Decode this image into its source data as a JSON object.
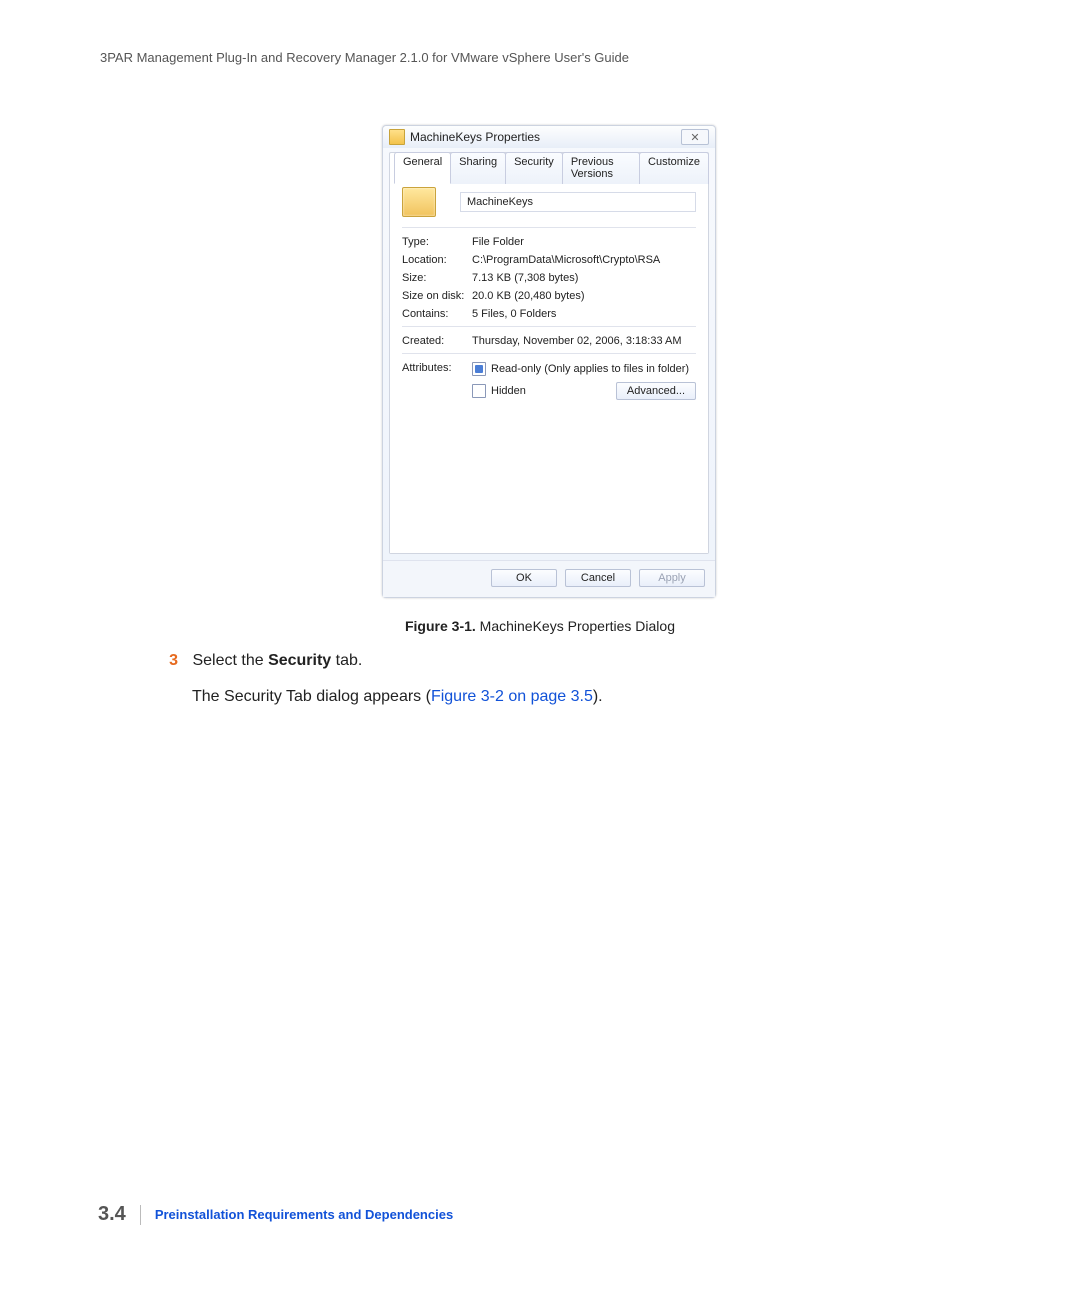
{
  "header": "3PAR Management Plug-In and Recovery Manager 2.1.0 for VMware vSphere User's Guide",
  "dialog": {
    "title": "MachineKeys Properties",
    "tabs": [
      "General",
      "Sharing",
      "Security",
      "Previous Versions",
      "Customize"
    ],
    "folderName": "MachineKeys",
    "props": {
      "type": {
        "label": "Type:",
        "value": "File Folder"
      },
      "location": {
        "label": "Location:",
        "value": "C:\\ProgramData\\Microsoft\\Crypto\\RSA"
      },
      "size": {
        "label": "Size:",
        "value": "7.13 KB (7,308 bytes)"
      },
      "sizeOnDisk": {
        "label": "Size on disk:",
        "value": "20.0 KB (20,480 bytes)"
      },
      "contains": {
        "label": "Contains:",
        "value": "5 Files, 0 Folders"
      },
      "created": {
        "label": "Created:",
        "value": "Thursday, November 02, 2006, 3:18:33 AM"
      },
      "attributes": {
        "label": "Attributes:"
      }
    },
    "checks": {
      "readonly": "Read-only (Only applies to files in folder)",
      "hidden": "Hidden"
    },
    "advanced": "Advanced...",
    "buttons": {
      "ok": "OK",
      "cancel": "Cancel",
      "apply": "Apply"
    }
  },
  "figure": {
    "label": "Figure 3-1.",
    "caption": "MachineKeys Properties Dialog"
  },
  "step": {
    "num": "3",
    "pre": "Select the ",
    "bold": "Security",
    "post": " tab."
  },
  "para2": {
    "pre": "The Security Tab dialog appears (",
    "link": "Figure 3-2 on page 3.5",
    "post": ")."
  },
  "footer": {
    "page": "3.4",
    "chapter": "Preinstallation Requirements and Dependencies"
  }
}
